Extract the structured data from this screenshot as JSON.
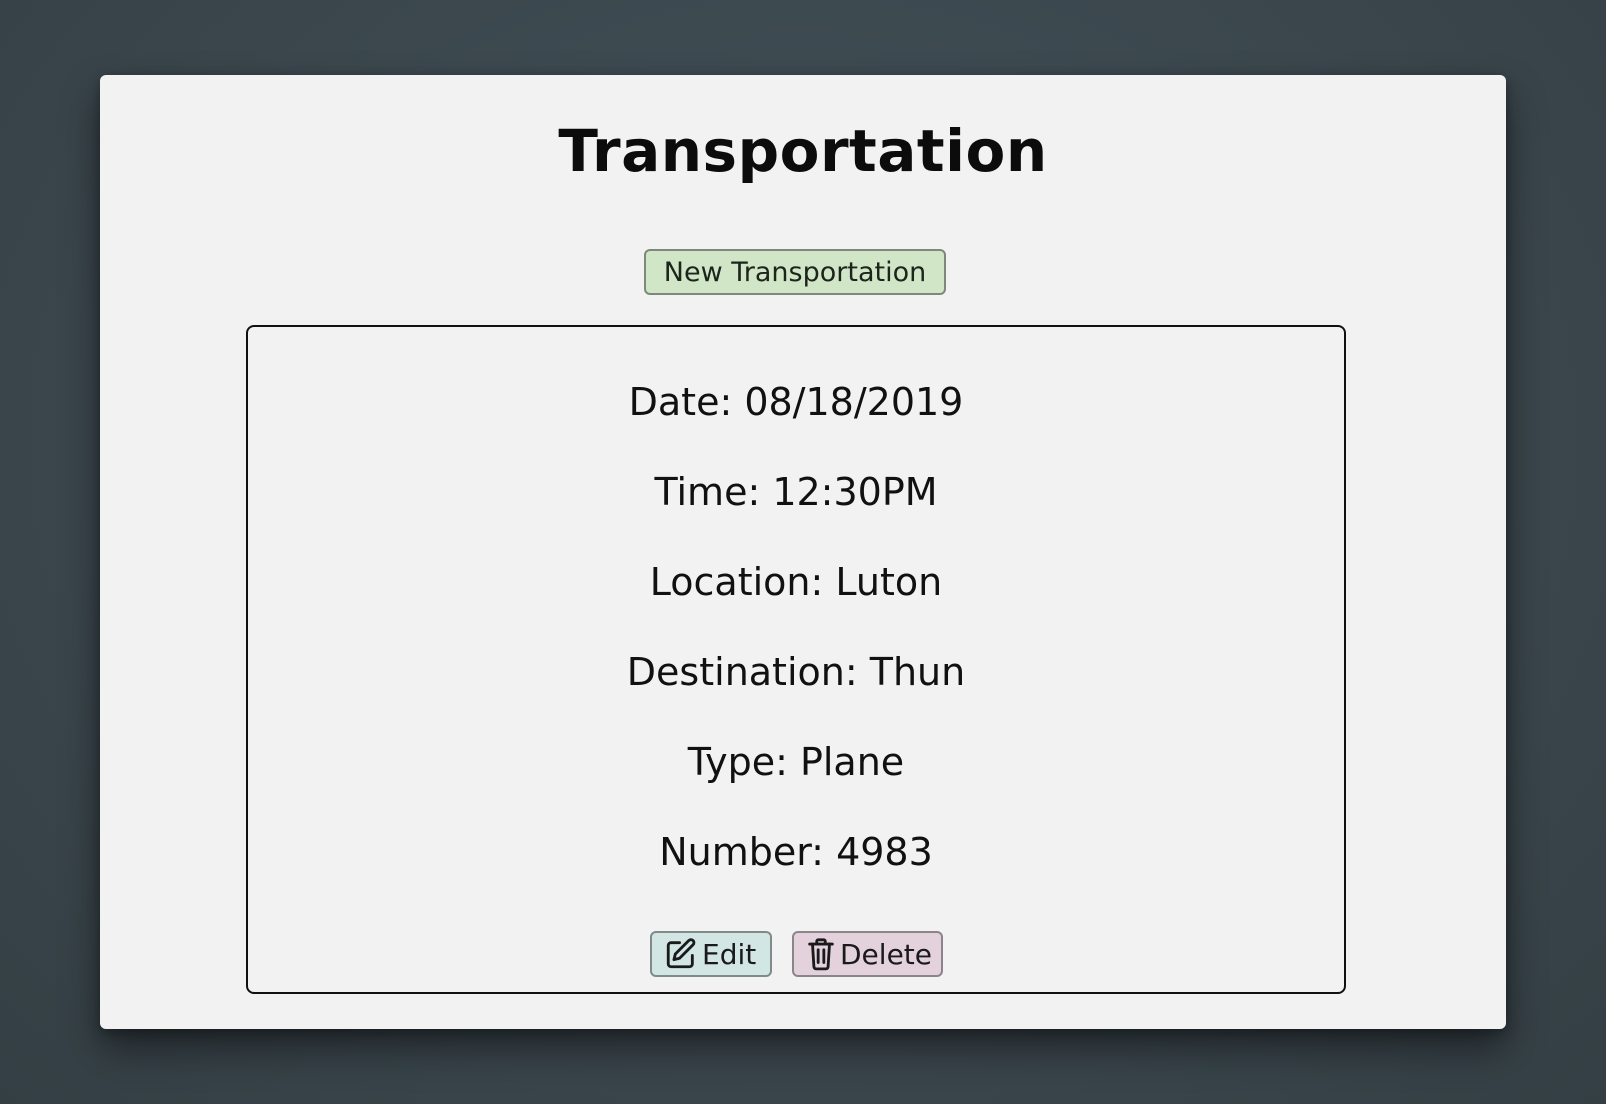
{
  "page": {
    "title": "Transportation"
  },
  "toolbar": {
    "new_label": "New Transportation"
  },
  "record": {
    "date": "Date: 08/18/2019",
    "time": "Time: 12:30PM",
    "location": "Location: Luton",
    "destination": "Destination: Thun",
    "type": "Type: Plane",
    "number": "Number: 4983"
  },
  "actions": {
    "edit_label": "Edit",
    "edit_icon": "edit-icon",
    "delete_label": "Delete",
    "delete_icon": "trash-icon"
  },
  "colors": {
    "background": "#3b474d",
    "panel": "#f2f2f2",
    "new_button": "#d0e6c6",
    "edit_button": "#d2e6e3",
    "delete_button": "#e3d2dc"
  }
}
